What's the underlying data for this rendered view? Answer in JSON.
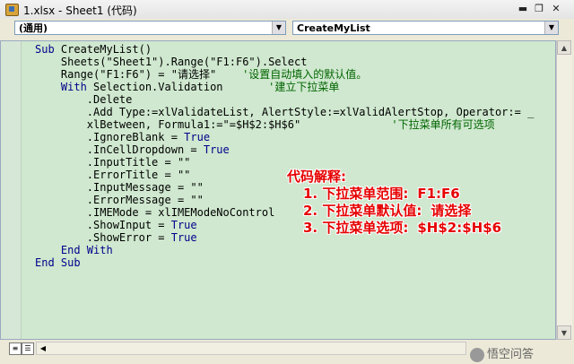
{
  "window": {
    "title": "1.xlsx - Sheet1 (代码)"
  },
  "controls": {
    "minimize": "▬",
    "maximize": "❐",
    "close": "✕"
  },
  "object_combo": {
    "value": "(通用)"
  },
  "proc_combo": {
    "value": "CreateMyList"
  },
  "code_lines": [
    [
      {
        "t": "Sub ",
        "c": "kw"
      },
      {
        "t": "CreateMyList()",
        "c": ""
      }
    ],
    [
      {
        "t": "    Sheets(\"Sheet1\").Range(\"F1:F6\").Select",
        "c": ""
      }
    ],
    [
      {
        "t": "    Range(\"F1:F6\") = \"请选择\"    ",
        "c": ""
      },
      {
        "t": "'设置自动填入的默认值。",
        "c": "cm"
      }
    ],
    [
      {
        "t": "    With ",
        "c": "kw"
      },
      {
        "t": "Selection.Validation       ",
        "c": ""
      },
      {
        "t": "'建立下拉菜单",
        "c": "cm"
      }
    ],
    [
      {
        "t": "        .Delete",
        "c": ""
      }
    ],
    [
      {
        "t": "        .Add Type:=xlValidateList, AlertStyle:=xlValidAlertStop, Operator:= _",
        "c": ""
      }
    ],
    [
      {
        "t": "        xlBetween, Formula1:=\"=$H$2:$H$6\"              ",
        "c": ""
      },
      {
        "t": "'下拉菜单所有可选项",
        "c": "cm"
      }
    ],
    [
      {
        "t": "        .IgnoreBlank = ",
        "c": ""
      },
      {
        "t": "True",
        "c": "kw"
      }
    ],
    [
      {
        "t": "        .InCellDropdown = ",
        "c": ""
      },
      {
        "t": "True",
        "c": "kw"
      }
    ],
    [
      {
        "t": "        .InputTitle = \"\"",
        "c": ""
      }
    ],
    [
      {
        "t": "        .ErrorTitle = \"\"",
        "c": ""
      }
    ],
    [
      {
        "t": "        .InputMessage = \"\"",
        "c": ""
      }
    ],
    [
      {
        "t": "        .ErrorMessage = \"\"",
        "c": ""
      }
    ],
    [
      {
        "t": "        .IMEMode = xlIMEModeNoControl",
        "c": ""
      }
    ],
    [
      {
        "t": "        .ShowInput = ",
        "c": ""
      },
      {
        "t": "True",
        "c": "kw"
      }
    ],
    [
      {
        "t": "        .ShowError = ",
        "c": ""
      },
      {
        "t": "True",
        "c": "kw"
      }
    ],
    [
      {
        "t": "    End With",
        "c": "kw"
      }
    ],
    [
      {
        "t": "End Sub",
        "c": "kw"
      }
    ]
  ],
  "annotation": {
    "heading": "代码解释:",
    "items": [
      {
        "label": "1. 下拉菜单范围:",
        "value": "F1:F6"
      },
      {
        "label": "2. 下拉菜单默认值:",
        "value": "请选择"
      },
      {
        "label": "3. 下拉菜单选项:",
        "value": "$H$2:$H$6"
      }
    ]
  },
  "watermark": {
    "text": "悟空问答"
  },
  "colors": {
    "editor_bg": "#cfe8cf",
    "keyword": "#00008b",
    "comment": "#006400",
    "annotation": "#e60000"
  }
}
